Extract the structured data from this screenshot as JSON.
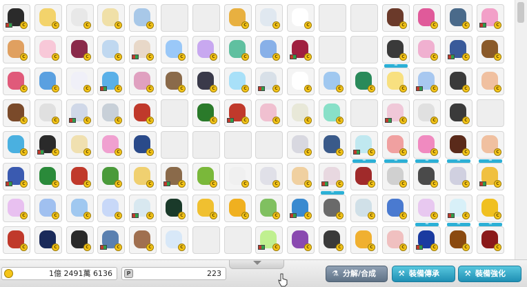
{
  "grid": {
    "rows": 8,
    "cols": 16,
    "slots": [
      [
        "leaf",
        "c",
        "c",
        "c",
        "c",
        "e",
        "e",
        "c",
        "c",
        "c",
        "e",
        "e",
        "c",
        "c",
        "c",
        "c"
      ],
      [
        "c",
        "c",
        "c",
        "c",
        "c",
        "c",
        "c",
        "c",
        "c",
        "c",
        "e",
        "e",
        "cb",
        "c",
        "c",
        "c"
      ],
      [
        "c",
        "c",
        "c",
        "c",
        "c",
        "c",
        "c",
        "c",
        "c",
        "c",
        "c",
        "c",
        "c",
        "c",
        "c",
        "c"
      ],
      [
        "c",
        "c",
        "c",
        "c",
        "c",
        "e",
        "c",
        "c",
        "c",
        "c",
        "c",
        "e",
        "c",
        "c",
        "c",
        "e"
      ],
      [
        "c",
        "c",
        "c",
        "c",
        "c",
        "e",
        "e",
        "e",
        "e",
        "c",
        "c",
        "cb",
        "cb",
        "cb",
        "cb",
        "cb"
      ],
      [
        "c",
        "c",
        "c",
        "c",
        "c",
        "c",
        "c",
        "c",
        "c",
        "c",
        "cb",
        "c",
        "c",
        "c",
        "c",
        "c"
      ],
      [
        "c",
        "c",
        "c",
        "c",
        "c",
        "c",
        "c",
        "c",
        "c",
        "c",
        "c",
        "c",
        "c",
        "cb",
        "cb",
        "cb"
      ],
      [
        "c",
        "c",
        "c",
        "c",
        "c",
        "c",
        "e",
        "e",
        "c",
        "c",
        "c",
        "c",
        "c",
        "c",
        "c",
        "c"
      ]
    ],
    "colors": [
      [
        "#2b2b2b",
        "#f3d36b",
        "#e8e8e8",
        "#f0e0a8",
        "#a8c8e8",
        "#c0392b",
        "#eeeeee",
        "#e8b040",
        "#e0e8f0",
        "#ffffff",
        "#eeeeee",
        "#eeeeee",
        "#6b3a2a",
        "#e05a9a",
        "#4a6a8a",
        "#f2a0c8"
      ],
      [
        "#e0a060",
        "#f8c8d8",
        "#8a2a4a",
        "#c0d8f0",
        "#e8d8c8",
        "#9ac8f8",
        "#c8a8f0",
        "#60c0a0",
        "#88b0e8",
        "#a02040",
        "#eeeeee",
        "#eeeeee",
        "#3a3a3a",
        "#f0b0d0",
        "#3a5a9a",
        "#8a5a2a"
      ],
      [
        "#e05a7a",
        "#5aa0e0",
        "#f0f0f8",
        "#5ab0e8",
        "#e0a0c0",
        "#8a6a4a",
        "#3a3a4a",
        "#a8e0f8",
        "#d8e0e8",
        "#ffffff",
        "#a0c8f0",
        "#2a8a5a",
        "#f8e080",
        "#a8c8f0",
        "#3a3a3a",
        "#f0c0a0"
      ],
      [
        "#7a4a2a",
        "#e0e0e0",
        "#d0d8e8",
        "#c8d0d8",
        "#c0392b",
        "#eeeeee",
        "#2a7a2a",
        "#c0392b",
        "#f0c0d0",
        "#e8e8d8",
        "#88e0c8",
        "#eeeeee",
        "#f0c8d8",
        "#e0e0e0",
        "#3a3a3a",
        "#eeeeee"
      ],
      [
        "#4ab0e0",
        "#2a2a2a",
        "#f0e0b0",
        "#f0a0d0",
        "#2a4a8a",
        "#eeeeee",
        "#eeeeee",
        "#eeeeee",
        "#eeeeee",
        "#d8d8e0",
        "#3a5a8a",
        "#c0e8f0",
        "#f0a0a0",
        "#f08ac0",
        "#5a2a1a",
        "#f0c0a0"
      ],
      [
        "#3a5ab0",
        "#2a8a3a",
        "#c0392b",
        "#4a9a3a",
        "#f0d070",
        "#8a6a4a",
        "#7ab83a",
        "#f0f0f0",
        "#e0e0e8",
        "#f0d0a0",
        "#e8d8e0",
        "#a02a2a",
        "#d0d0d0",
        "#4a4a4a",
        "#d0d0e0",
        "#f0c040"
      ],
      [
        "#e8c0f0",
        "#a0c0f0",
        "#a0c8f0",
        "#c8d8f8",
        "#d8e8f0",
        "#1a3a2a",
        "#f0c030",
        "#f0b020",
        "#80c060",
        "#3a8ad0",
        "#6a6a6a",
        "#d0e0e8",
        "#4a7ad0",
        "#e8c8f0",
        "#d8f0f8",
        "#f0c020"
      ],
      [
        "#c0392b",
        "#1a2a5a",
        "#2a2a2a",
        "#5a80b0",
        "#a07050",
        "#d8e8f8",
        "#eeeeee",
        "#eeeeee",
        "#c0f090",
        "#8a4ab0",
        "#3a3a3a",
        "#f0b030",
        "#f0c0c0",
        "#1a3aa0",
        "#8a4a10",
        "#8a1a1a"
      ]
    ]
  },
  "footer": {
    "meso_value": "1億 2491萬 6136",
    "point_value": "223",
    "buttons": {
      "disassemble": "分解/合成",
      "inherit": "裝備傳承",
      "enhance": "裝備強化"
    }
  },
  "accent_color": "#2bb0d6",
  "coin_glyph": "C"
}
